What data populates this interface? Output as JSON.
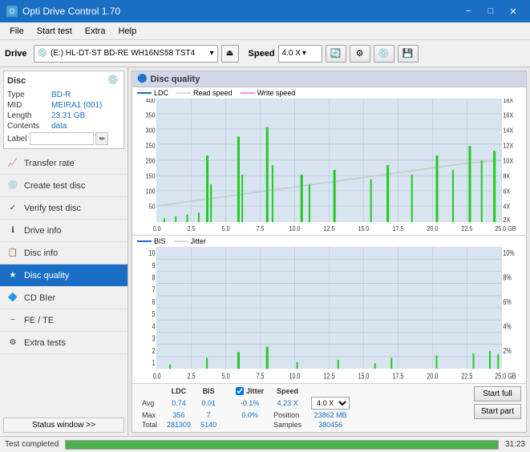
{
  "titleBar": {
    "title": "Opti Drive Control 1.70",
    "minimize": "−",
    "maximize": "□",
    "close": "✕"
  },
  "menuBar": {
    "items": [
      "File",
      "Start test",
      "Extra",
      "Help"
    ]
  },
  "toolbar": {
    "driveLabel": "Drive",
    "driveValue": "(E:)  HL-DT-ST BD-RE  WH16NS58 TST4",
    "speedLabel": "Speed",
    "speedValue": "4.0 X"
  },
  "discPanel": {
    "title": "Disc",
    "rows": [
      {
        "label": "Type",
        "value": "BD-R"
      },
      {
        "label": "MID",
        "value": "MEIRA1 (001)"
      },
      {
        "label": "Length",
        "value": "23.31 GB"
      },
      {
        "label": "Contents",
        "value": "data"
      }
    ],
    "labelLabel": "Label"
  },
  "navItems": [
    {
      "id": "transfer-rate",
      "label": "Transfer rate",
      "icon": "📈",
      "active": false
    },
    {
      "id": "create-test-disc",
      "label": "Create test disc",
      "icon": "💿",
      "active": false
    },
    {
      "id": "verify-test-disc",
      "label": "Verify test disc",
      "icon": "✓",
      "active": false
    },
    {
      "id": "drive-info",
      "label": "Drive info",
      "icon": "ℹ",
      "active": false
    },
    {
      "id": "disc-info",
      "label": "Disc info",
      "icon": "📋",
      "active": false
    },
    {
      "id": "disc-quality",
      "label": "Disc quality",
      "icon": "★",
      "active": true
    },
    {
      "id": "cd-bier",
      "label": "CD BIer",
      "icon": "🔷",
      "active": false
    },
    {
      "id": "fe-te",
      "label": "FE / TE",
      "icon": "~",
      "active": false
    },
    {
      "id": "extra-tests",
      "label": "Extra tests",
      "icon": "⚙",
      "active": false
    }
  ],
  "statusWindow": "Status window >>",
  "qualityPanel": {
    "title": "Disc quality",
    "chart1": {
      "legend": [
        "LDC",
        "Read speed",
        "Write speed"
      ],
      "yMax": 400,
      "yLabels": [
        "400",
        "350",
        "300",
        "250",
        "200",
        "150",
        "100",
        "50"
      ],
      "yRight": [
        "18X",
        "16X",
        "14X",
        "12X",
        "10X",
        "8X",
        "6X",
        "4X",
        "2X"
      ],
      "xLabels": [
        "0.0",
        "2.5",
        "5.0",
        "7.5",
        "10.0",
        "12.5",
        "15.0",
        "17.5",
        "20.0",
        "22.5",
        "25.0 GB"
      ]
    },
    "chart2": {
      "legend": [
        "BIS",
        "Jitter"
      ],
      "yMax": 10,
      "yLabels": [
        "10",
        "9",
        "8",
        "7",
        "6",
        "5",
        "4",
        "3",
        "2",
        "1"
      ],
      "yRight": [
        "10%",
        "8%",
        "6%",
        "4%",
        "2%"
      ],
      "xLabels": [
        "0.0",
        "2.5",
        "5.0",
        "7.5",
        "10.0",
        "12.5",
        "15.0",
        "17.5",
        "20.0",
        "22.5",
        "25.0 GB"
      ]
    }
  },
  "stats": {
    "headers": [
      "",
      "LDC",
      "BIS",
      "",
      "Jitter",
      "Speed",
      ""
    ],
    "rows": [
      {
        "label": "Avg",
        "ldc": "0.74",
        "bis": "0.01",
        "jitter": "-0.1%",
        "speed": "4.23 X"
      },
      {
        "label": "Max",
        "ldc": "356",
        "bis": "7",
        "jitter": "0.0%",
        "position": "23862 MB"
      },
      {
        "label": "Total",
        "ldc": "281309",
        "bis": "5140",
        "samples": "380456"
      }
    ],
    "speedSelect": "4.0 X",
    "positionLabel": "Position",
    "samplesLabel": "Samples",
    "jitterChecked": true,
    "jitterLabel": "Jitter"
  },
  "buttons": {
    "startFull": "Start full",
    "startPart": "Start part"
  },
  "statusBar": {
    "text": "Test completed",
    "progress": 100,
    "time": "31:23"
  }
}
